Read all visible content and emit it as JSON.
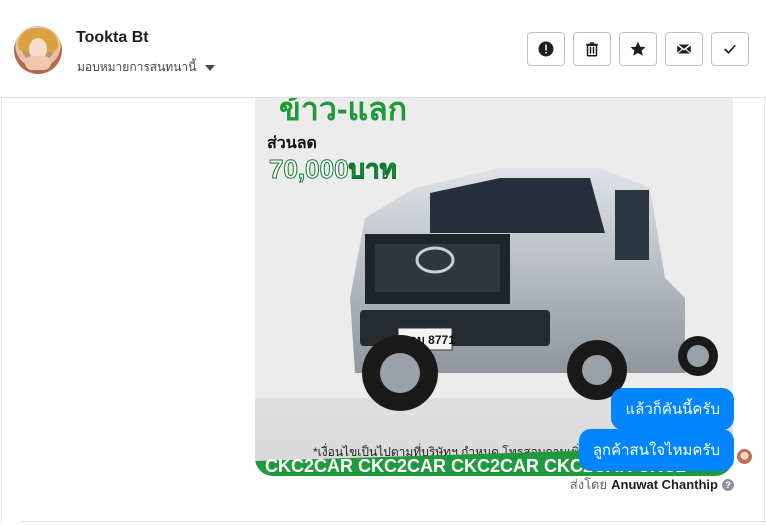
{
  "header": {
    "name": "Tookta Bt",
    "assign_label": "มอบหมายการสนทนานี้",
    "actions": [
      {
        "icon": "alert-icon"
      },
      {
        "icon": "trash-icon"
      },
      {
        "icon": "star-icon"
      },
      {
        "icon": "mail-icon"
      },
      {
        "icon": "check-icon"
      }
    ]
  },
  "image": {
    "promo_prefix": "ข้าว-แลก",
    "discount_label": "ส่วนลด",
    "discount_amount": "70,000บาท",
    "plate": "6กม 8771",
    "note": "*เงื่อนไขเป็นไปตามที่บริษัทฯ กำหนด โทรสอบถามเพิ่มเติมได้ที่ 088-5577932",
    "ribbon": "CKC2CAR CKC2CAR CKC2CAR CKC2CAR CKC2"
  },
  "messages": [
    {
      "text": "แล้วก็คันนี้ครับ"
    },
    {
      "text": "ลูกค้าสนใจไหมครับ"
    }
  ],
  "sent_by": {
    "prefix": "ส่งโดย",
    "name": "Anuwat Chanthip"
  }
}
